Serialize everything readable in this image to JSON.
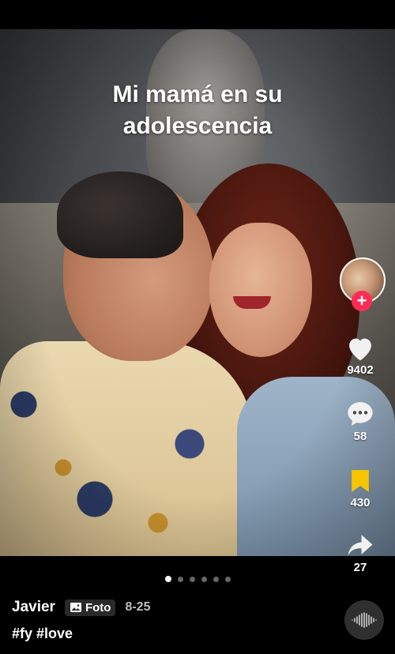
{
  "post": {
    "caption_line1": "Mi mamá en su",
    "caption_line2": "adolescencia",
    "author": "Javier",
    "type_badge": "Foto",
    "date": "8-25",
    "hashtags": "#fy #love"
  },
  "rail": {
    "likes": "9402",
    "comments": "58",
    "saves": "430",
    "shares": "27",
    "follow_symbol": "+"
  },
  "carousel": {
    "total": 6,
    "active": 0
  },
  "icons": {
    "like": "heart-icon",
    "comment": "comment-bubble-icon",
    "save": "bookmark-icon",
    "share": "share-arrow-icon",
    "badge": "photo-icon",
    "music": "music-wave-icon"
  },
  "colors": {
    "accent": "#fe2c55",
    "bookmark": "#f7c500",
    "background": "#000000"
  }
}
